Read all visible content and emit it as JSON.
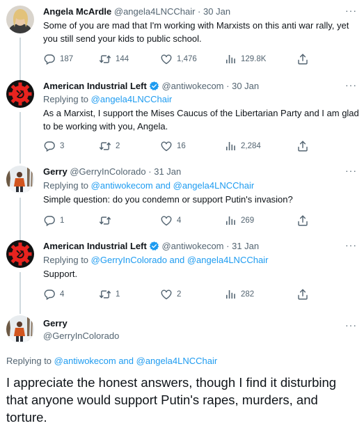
{
  "tweets": [
    {
      "name": "Angela McArdle",
      "handle": "@angela4LNCChair",
      "date": "30 Jan",
      "text": "Some of you are mad that I'm working with Marxists on this anti war rally, yet you still send your kids to public school.",
      "replies": "187",
      "retweets": "144",
      "likes": "1,476",
      "views": "129.8K"
    },
    {
      "name": "American Industrial Left",
      "handle": "@antiwokecom",
      "date": "30 Jan",
      "replying_prefix": "Replying to ",
      "replying_to": "@angela4LNCChair",
      "text": "As a Marxist, I support the Mises Caucus of the Libertarian Party and I am glad to be working with you, Angela.",
      "replies": "3",
      "retweets": "2",
      "likes": "16",
      "views": "2,284"
    },
    {
      "name": "Gerry",
      "handle": "@GerryInColorado",
      "date": "31 Jan",
      "replying_prefix": "Replying to ",
      "replying_to": "@antiwokecom and @angela4LNCChair",
      "text": "Simple question: do you condemn or support Putin's invasion?",
      "replies": "1",
      "retweets": "",
      "likes": "4",
      "views": "269"
    },
    {
      "name": "American Industrial Left",
      "handle": "@antiwokecom",
      "date": "31 Jan",
      "replying_prefix": "Replying to ",
      "replying_to": "@GerryInColorado and @angela4LNCChair",
      "text": "Support.",
      "replies": "4",
      "retweets": "1",
      "likes": "2",
      "views": "282"
    }
  ],
  "main_tweet": {
    "name": "Gerry",
    "handle": "@GerryInColorado",
    "replying_prefix": "Replying to ",
    "replying_to": "@antiwokecom and @angela4LNCChair",
    "text": "I appreciate the honest answers, though I find it disturbing that anyone would support Putin's rapes, murders, and torture."
  },
  "separator": "·",
  "more_label": "···",
  "colors": {
    "accent": "#1d9bf0",
    "muted": "#536471",
    "text": "#0f1419",
    "thread_line": "#cfd9de",
    "logo_red": "#e8231f"
  },
  "icons": {
    "reply": "reply-icon",
    "retweet": "retweet-icon",
    "like": "heart-icon",
    "views": "views-icon",
    "share": "share-icon",
    "verified": "verified-badge-icon"
  }
}
